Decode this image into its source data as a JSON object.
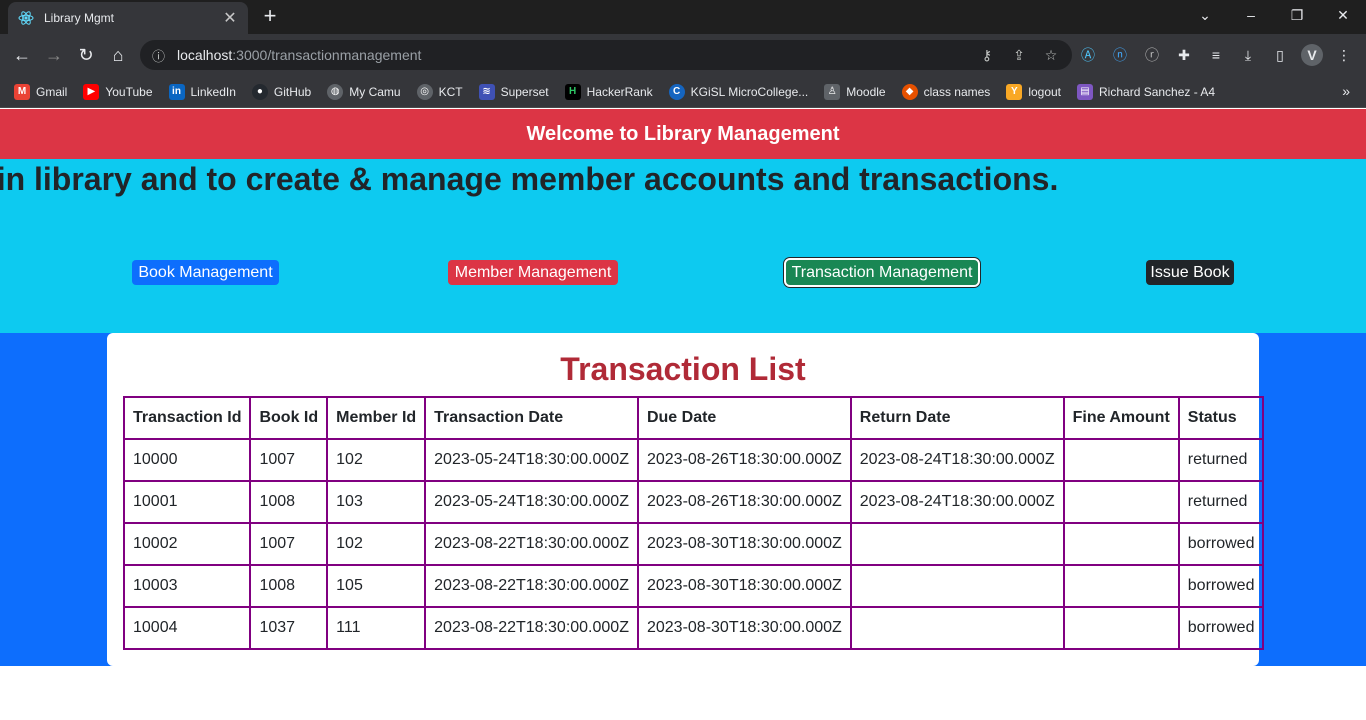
{
  "browser": {
    "tab_title": "Library Mgmt",
    "url_host": "localhost",
    "url_path": ":3000/transactionmanagement",
    "bookmarks": [
      "Gmail",
      "YouTube",
      "LinkedIn",
      "GitHub",
      "My Camu",
      "KCT",
      "Superset",
      "HackerRank",
      "KGiSL MicroCollege...",
      "Moodle",
      "class names",
      "logout",
      "Richard Sanchez - A4"
    ],
    "profile_initial": "V"
  },
  "header": {
    "title": "Welcome to Library Management"
  },
  "hero": {
    "marquee": "s in library and to create & manage member accounts and transactions."
  },
  "nav": {
    "book_management": "Book Management",
    "member_management": "Member Management",
    "transaction_management": "Transaction Management",
    "issue_book": "Issue Book"
  },
  "colors": {
    "header": "#dc3545",
    "hero": "#0dcaf0",
    "content": "#0d6efd",
    "title": "#b02a37",
    "table_border": "#800080"
  },
  "transactions": {
    "title": "Transaction List",
    "columns": [
      "Transaction Id",
      "Book Id",
      "Member Id",
      "Transaction Date",
      "Due Date",
      "Return Date",
      "Fine Amount",
      "Status"
    ],
    "rows": [
      [
        "10000",
        "1007",
        "102",
        "2023-05-24T18:30:00.000Z",
        "2023-08-26T18:30:00.000Z",
        "2023-08-24T18:30:00.000Z",
        "",
        "returned"
      ],
      [
        "10001",
        "1008",
        "103",
        "2023-05-24T18:30:00.000Z",
        "2023-08-26T18:30:00.000Z",
        "2023-08-24T18:30:00.000Z",
        "",
        "returned"
      ],
      [
        "10002",
        "1007",
        "102",
        "2023-08-22T18:30:00.000Z",
        "2023-08-30T18:30:00.000Z",
        "",
        "",
        "borrowed"
      ],
      [
        "10003",
        "1008",
        "105",
        "2023-08-22T18:30:00.000Z",
        "2023-08-30T18:30:00.000Z",
        "",
        "",
        "borrowed"
      ],
      [
        "10004",
        "1037",
        "111",
        "2023-08-22T18:30:00.000Z",
        "2023-08-30T18:30:00.000Z",
        "",
        "",
        "borrowed"
      ]
    ]
  }
}
